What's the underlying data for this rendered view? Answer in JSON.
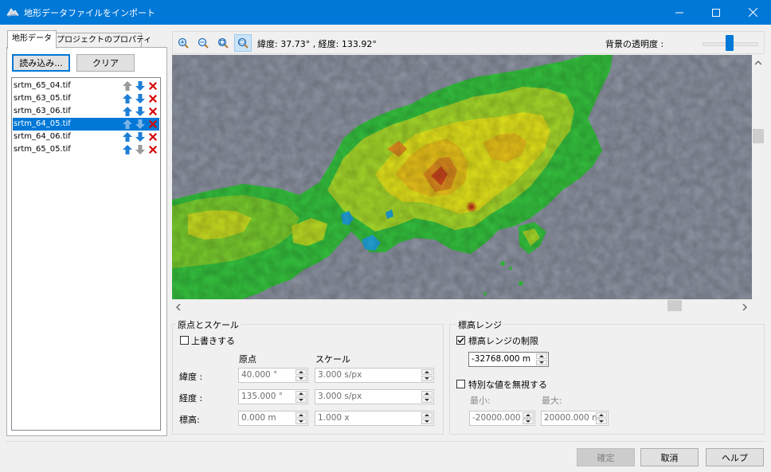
{
  "window": {
    "title": "地形データファイルをインポート"
  },
  "tabs": [
    {
      "label": "地形データ",
      "active": true
    },
    {
      "label": "プロジェクトのプロパティ",
      "active": false
    }
  ],
  "left": {
    "load_button": "読み込み...",
    "clear_button": "クリア",
    "files": [
      {
        "name": "srtm_65_04.tif",
        "selected": false
      },
      {
        "name": "srtm_63_05.tif",
        "selected": false
      },
      {
        "name": "srtm_63_06.tif",
        "selected": false
      },
      {
        "name": "srtm_64_05.tif",
        "selected": true
      },
      {
        "name": "srtm_64_06.tif",
        "selected": false
      },
      {
        "name": "srtm_65_05.tif",
        "selected": false
      }
    ]
  },
  "map": {
    "coords": "緯度: 37.73° , 経度: 133.92°",
    "bg_opacity_label": "背景の透明度 :",
    "bg_opacity_level": 0.45
  },
  "origin_scale": {
    "title": "原点とスケール",
    "overwrite_label": "上書きする",
    "overwrite_checked": false,
    "col_origin": "原点",
    "col_scale": "スケール",
    "rows": [
      {
        "label": "緯度 :",
        "origin": "40.000 °",
        "scale": "3.000 s/px"
      },
      {
        "label": "経度 :",
        "origin": "135.000 °",
        "scale": "3.000 s/px"
      },
      {
        "label": "標高:",
        "origin": "0.000 m",
        "scale": "1.000 x"
      }
    ]
  },
  "elevation": {
    "title": "標高レンジ",
    "limit_label": "標高レンジの制限",
    "limit_checked": true,
    "limit_value": "-32768.000 m",
    "ignore_label": "特別な値を無視する",
    "ignore_checked": false,
    "min_label": "最小:",
    "max_label": "最大:",
    "min_value": "-20000.000 m",
    "max_value": "20000.000 m"
  },
  "footer": {
    "ok_button": "確定",
    "cancel_button": "取消",
    "help_button": "ヘルプ"
  },
  "colors": {
    "accent": "#0078d7",
    "ocean": "#8a91a0",
    "low": "#2fbf3c",
    "mid": "#e6e21a",
    "high": "#d8761e",
    "peak": "#c63a1c",
    "remove": "#d40000"
  }
}
